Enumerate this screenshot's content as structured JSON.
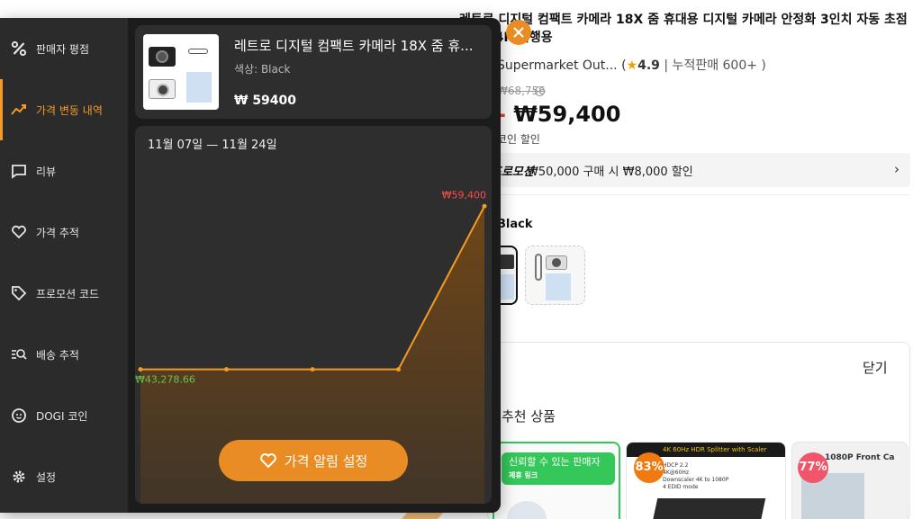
{
  "background": {
    "title": "레트로 디지털 컴팩트 카메라 18X 줌 휴대용 디지털 카메라 안정화 3인치 자동 초점 UHD 4K 여행용",
    "store_name": "Supermarket Out... (",
    "rating": "4.9",
    "sold": "| 누적판매 600+ )",
    "original_price": "₩68,756",
    "price": "₩59,400",
    "price_prefix": "-",
    "coin_discount": "코인 할인",
    "promo_tag": "프로모션",
    "promo_text": "₩50,000 구매 시 ₩8,000 할인",
    "color_label": "Black",
    "close_label": "닫기",
    "section_label": "추천 상품",
    "trusted_seller_tag": "신뢰할 수 있는 판매자",
    "trusted_seller_sub": "제휴 링크",
    "card2_header": "4K 60Hz HDR Splitter with Scaler",
    "card2_specs": [
      "HDCP 2.2",
      "4K@60Hz",
      "Downscaler 4K to 1080P",
      "4 EDID mode"
    ],
    "card3_header": "1080P Front Ca",
    "badge_a": "83%",
    "badge_b": "77%"
  },
  "sidebar": {
    "items": [
      {
        "label": "판매자 평점",
        "icon": "percent-icon"
      },
      {
        "label": "가격 변동 내역",
        "icon": "trend-icon"
      },
      {
        "label": "리뷰",
        "icon": "comment-icon"
      },
      {
        "label": "가격 추적",
        "icon": "heart-icon"
      },
      {
        "label": "프로모션 코드",
        "icon": "tag-icon"
      },
      {
        "label": "배송 추적",
        "icon": "track-icon"
      },
      {
        "label": "DOGI 코인",
        "icon": "coin-icon"
      },
      {
        "label": "설정",
        "icon": "gear-icon"
      }
    ],
    "active_index": 1
  },
  "product": {
    "name": "레트로 디지털 컴팩트 카메라 18X 줌 휴...",
    "variant": "색상: Black",
    "price": "₩ 59400"
  },
  "chart": {
    "date_range": "11월 07일 — 11월 24일",
    "start_label": "₩43,278.66",
    "end_label": "₩59,400",
    "alert_button": "가격 알림 설정"
  },
  "chart_data": {
    "type": "line",
    "x": [
      0,
      1,
      2,
      3,
      4
    ],
    "values": [
      43278.66,
      43278.66,
      43278.66,
      43278.66,
      59400
    ],
    "ylim": [
      30000,
      62000
    ],
    "annotations": [
      "₩43,278.66",
      "₩59,400"
    ],
    "line_color": "#f39a27",
    "fill_color": "#7a4a14",
    "grid": false
  },
  "colors": {
    "accent": "#f39a27",
    "button": "#e98c23",
    "low_label": "#6cc24a",
    "high_label": "#ff4d4d"
  }
}
